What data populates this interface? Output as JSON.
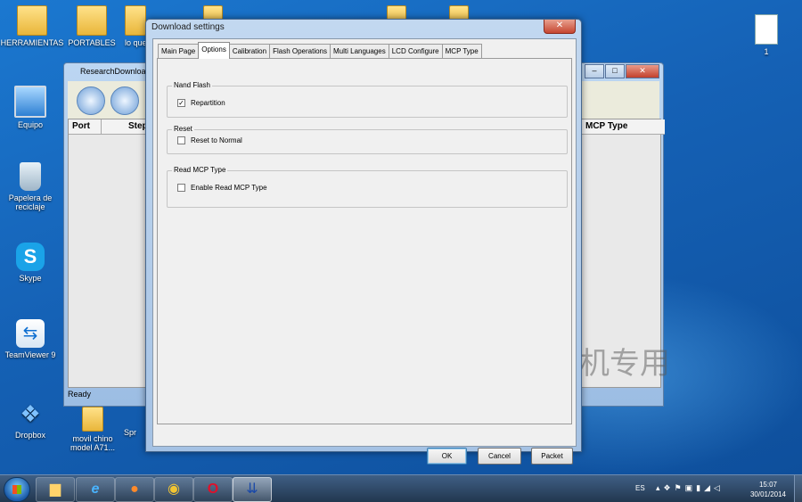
{
  "desktop": {
    "icons": {
      "herramientas": "HERRAMIENTAS",
      "portables": "PORTABLES",
      "lo_que": "lo que",
      "equipo": "Equipo",
      "papelera": "Papelera de reciclaje",
      "skype": "Skype",
      "teamviewer": "TeamViewer 9",
      "dropbox": "Dropbox",
      "movil_chino": "movil chino model A71...",
      "spr": "Spr",
      "doc_1": "1"
    }
  },
  "background_window": {
    "title": "ResearchDownload",
    "columns": {
      "port": "Port",
      "step": "Step",
      "mcp_type": "MCP Type"
    },
    "status": "Ready",
    "watermark": "机专用"
  },
  "dialog": {
    "title": "Download settings",
    "close_glyph": "✕",
    "tabs": [
      "Main Page",
      "Options",
      "Calibration",
      "Flash Operations",
      "Multi Languages",
      "LCD Configure",
      "MCP Type"
    ],
    "active_tab": "Options",
    "groups": {
      "nand_flash": {
        "legend": "Nand Flash",
        "option_label": "Repartition",
        "checked": true
      },
      "reset": {
        "legend": "Reset",
        "option_label": "Reset to Normal",
        "checked": false
      },
      "read_mcp": {
        "legend": "Read MCP Type",
        "option_label": "Enable Read MCP Type",
        "checked": false
      }
    },
    "buttons": {
      "ok": "OK",
      "cancel": "Cancel",
      "packet": "Packet"
    }
  },
  "taskbar": {
    "language": "ES",
    "time": "15:07",
    "date": "30/01/2014",
    "apps": [
      "explorer",
      "internet-explorer",
      "firefox",
      "chrome",
      "opera",
      "research-download"
    ]
  },
  "colors": {
    "desktop_blue": "#1561b5",
    "dialog_frame": "#a5c2e4",
    "close_red": "#c64630"
  }
}
